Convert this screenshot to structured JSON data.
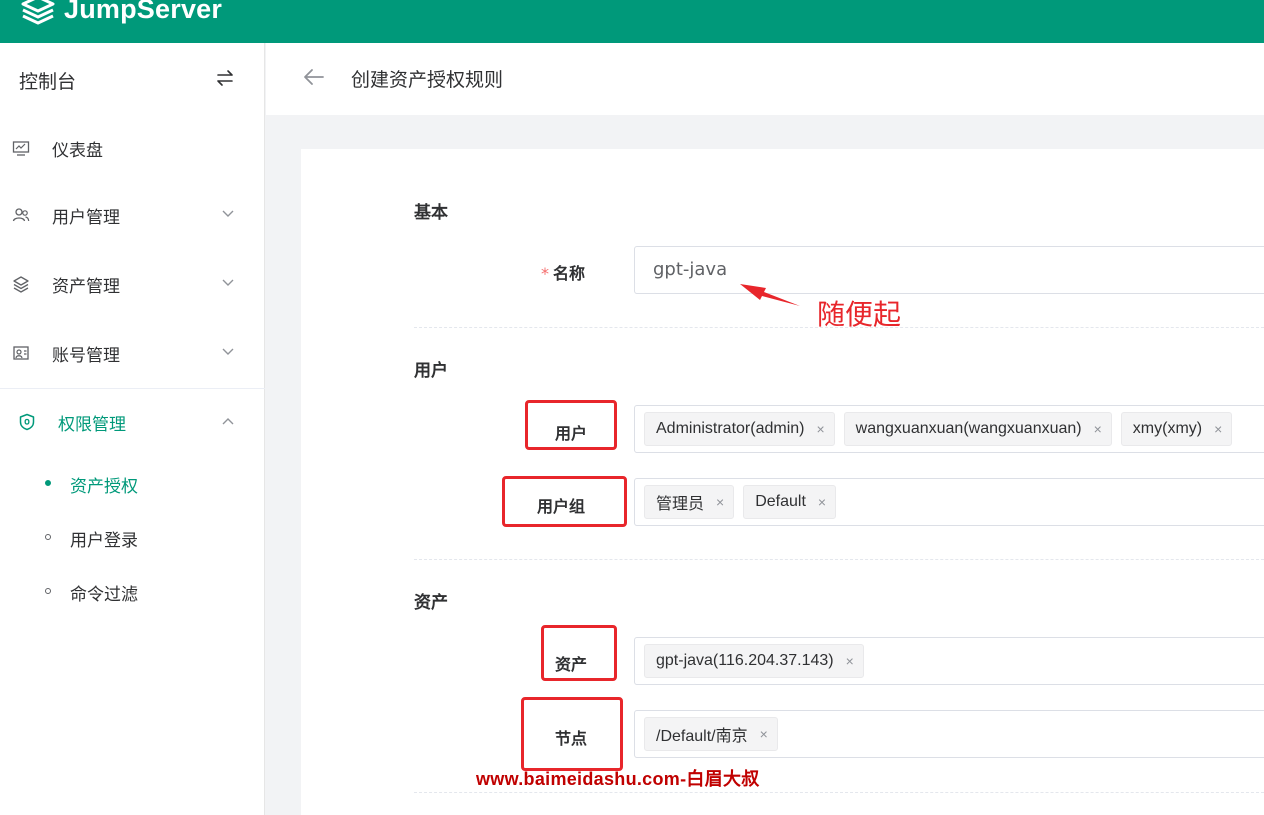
{
  "header": {
    "logo_text": "JumpServer",
    "brand_color": "#00997a"
  },
  "sidebar": {
    "title": "控制台",
    "swap_icon": "swap-icon",
    "items": [
      {
        "label": "仪表盘",
        "icon": "dashboard-icon",
        "has_chevron": false
      },
      {
        "label": "用户管理",
        "icon": "users-icon",
        "has_chevron": true
      },
      {
        "label": "资产管理",
        "icon": "layers-icon",
        "has_chevron": true
      },
      {
        "label": "账号管理",
        "icon": "account-icon",
        "has_chevron": true
      },
      {
        "label": "权限管理",
        "icon": "shield-icon",
        "has_chevron": true,
        "expanded": true,
        "active": true
      }
    ],
    "sub_items": [
      {
        "label": "资产授权",
        "active": true
      },
      {
        "label": "用户登录",
        "active": false
      },
      {
        "label": "命令过滤",
        "active": false
      }
    ]
  },
  "page": {
    "title": "创建资产授权规则"
  },
  "form": {
    "sections": {
      "basic": "基本",
      "user": "用户",
      "asset": "资产"
    },
    "name_label": "名称",
    "name_value": "gpt-java",
    "users_label": "用户",
    "users": [
      "Administrator(admin)",
      "wangxuanxuan(wangxuanxuan)",
      "xmy(xmy)"
    ],
    "user_groups_label": "用户组",
    "user_groups": [
      "管理员",
      "Default"
    ],
    "assets_label": "资产",
    "assets": [
      "gpt-java(116.204.37.143)"
    ],
    "nodes_label": "节点",
    "nodes": [
      "/Default/南京"
    ],
    "tag_close": "×"
  },
  "annotations": {
    "arrow_text": "随便起",
    "watermark": "www.baimeidashu.com-白眉大叔",
    "color": "#e8262b"
  }
}
